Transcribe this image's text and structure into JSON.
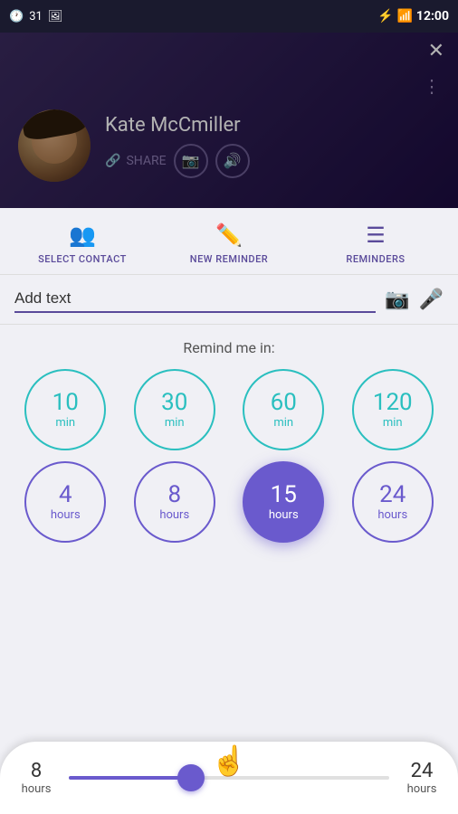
{
  "statusBar": {
    "time": "12:00",
    "leftIcons": [
      "31",
      "cal"
    ]
  },
  "header": {
    "closeLabel": "✕",
    "contactName": "Kate McCmiller",
    "shareLabel": "SHARE",
    "moreDots": "⋮"
  },
  "tabs": [
    {
      "id": "select-contact",
      "label": "SELECT CONTACT",
      "icon": "👥"
    },
    {
      "id": "new-reminder",
      "label": "NEW REMINDER",
      "icon": "✏️"
    },
    {
      "id": "reminders",
      "label": "REMINDERS",
      "icon": "☰"
    }
  ],
  "addText": {
    "placeholder": "Add text",
    "value": "Add text"
  },
  "remindSection": {
    "title": "Remind me in:",
    "row1": [
      {
        "number": "10",
        "unit": "min",
        "style": "teal"
      },
      {
        "number": "30",
        "unit": "min",
        "style": "teal"
      },
      {
        "number": "60",
        "unit": "min",
        "style": "teal"
      },
      {
        "number": "120",
        "unit": "min",
        "style": "teal"
      }
    ],
    "row2": [
      {
        "number": "4",
        "unit": "hours",
        "style": "purple"
      },
      {
        "number": "8",
        "unit": "hours",
        "style": "purple"
      },
      {
        "number": "15",
        "unit": "hours",
        "style": "active"
      },
      {
        "number": "24",
        "unit": "hours",
        "style": "purple"
      }
    ]
  },
  "slider": {
    "minNumber": "8",
    "minUnit": "hours",
    "maxNumber": "24",
    "maxUnit": "hours",
    "fillPercent": "38"
  }
}
